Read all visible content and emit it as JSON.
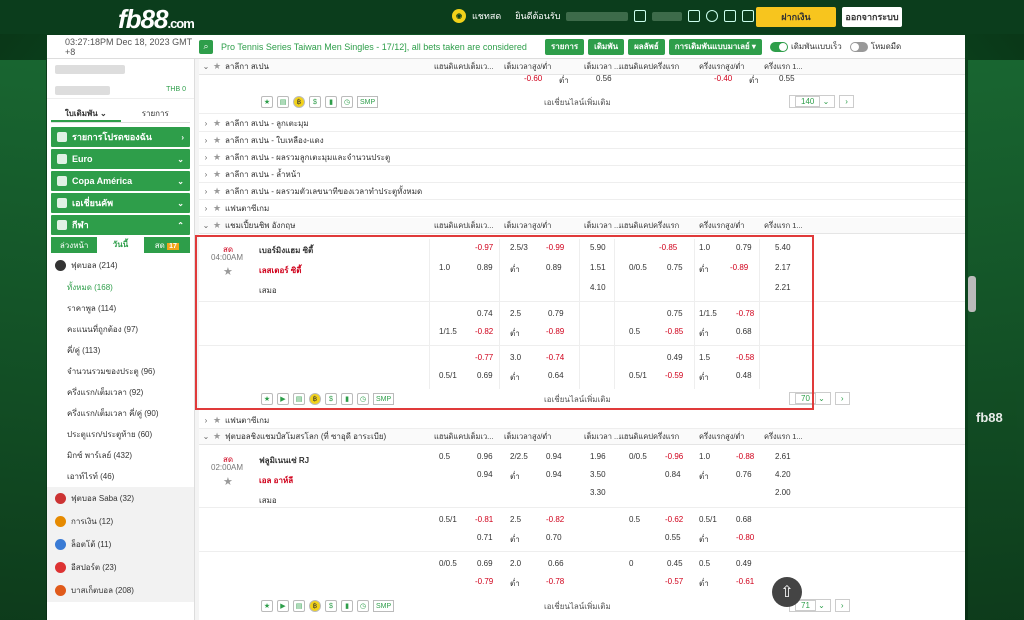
{
  "brand": {
    "logo": "fb88",
    "logo_suffix": ".com"
  },
  "header": {
    "chat_label": "แชทสด",
    "welcome": "ยินดีต้อนรับ",
    "deposit": "ฝากเงิน",
    "logout": "ออกจากระบบ"
  },
  "topbar": {
    "time": "03:27:18PM Dec 18, 2023 GMT +8",
    "ticker": "Pro Tennis Series Taiwan Men Singles - 17/12], all bets taken are considered",
    "btn1": "รายการ",
    "btn2": "เดิมพัน",
    "btn3": "ผลลัพธ์",
    "btn4": "การเดิมพันแบบมาเลย์",
    "toggle1": "เดิมพันแบบเร็ว",
    "toggle2": "โหมดมืด"
  },
  "sidebar": {
    "balance": "THB 0",
    "tab_bet": "ใบเดิมพัน",
    "tab_list": "รายการ",
    "acc1": "รายการโปรดของฉัน",
    "acc2": "Euro",
    "acc3": "Copa América",
    "acc4": "เอเชี่ยนคัพ",
    "acc5": "กีฬา",
    "sub_early": "ล่วงหน้า",
    "sub_today": "วันนี้",
    "sub_live": "สด",
    "live_count": "17",
    "football": "ฟุตบอล (214)",
    "items": [
      "ทั้งหมด (168)",
      "ราคาพูล (114)",
      "คะแนนที่ถูกต้อง (97)",
      "คี่/คู่ (113)",
      "จำนวนรวมของประตู (96)",
      "ครึ่งแรก/เต็มเวลา (92)",
      "ครึ่งแรก/เต็มเวลา คี่/คู่ (90)",
      "ประตูแรก/ประตูท้าย (60)",
      "มิกซ์ พาร์เลย์ (432)",
      "เอาท์ไรท์ (46)"
    ],
    "sports": [
      "ฟุตบอล Saba (32)",
      "การเงิน (12)",
      "ล็อตโต้ (11)",
      "อีสปอร์ต (23)",
      "บาสเก็ตบอล (208)"
    ]
  },
  "cols": {
    "c1": "แฮนดิแคปเต็มเว...",
    "c2": "เต็มเวลาสูง/ต่ำ",
    "c3": "เต็มเวลา ...",
    "c4": "แฮนดิแคปครึ่งแรก",
    "c5": "ครึ่งแรกสูง/ต่ำ",
    "c6": "ครึ่งแรก 1..."
  },
  "leagues": {
    "spain": "ลาลีกา สเปน",
    "l1": "ลาลีกา สเปน - ลูกเตะมุม",
    "l2": "ลาลีกา สเปน - ใบเหลือง-แดง",
    "l3": "ลาลีกา สเปน - ผลรวมลูกเตะมุมและจำนวนประตู",
    "l4": "ลาลีกา สเปน - ล้ำหน้า",
    "l5": "ลาลีกา สเปน - ผลรวมตัวเลขนาทีของเวลาทำประตูทั้งหมด",
    "fan": "แฟนตาซีเกม",
    "epl": "แชมเปี้ยนชิพ อังกฤษ",
    "fan2": "แฟนตาซีเกม",
    "cwc": "ฟุตบอลชิงแชมป์สโมสรโลก (ที่ ซาอุดี อาระเบีย)"
  },
  "top": {
    "v1": "-0.60",
    "v2": "ต่ำ",
    "v3": "0.56",
    "v4": "-0.40",
    "v5": "ต่ำ",
    "v6": "0.55",
    "more": "เอเชี่ยนไลน์เพิ่มเติม",
    "count": "140"
  },
  "m1": {
    "status": "สด",
    "time": "04:00AM",
    "home": "เบอร์มิงแฮม ซิตี้",
    "away": "เลสเตอร์ ซิตี้",
    "draw": "เสมอ",
    "count": "70",
    "more": "เอเชี่ยนไลน์เพิ่มเติม",
    "r1": [
      "-0.97",
      "2.5/3",
      "-0.99",
      "5.90",
      "-0.85",
      "1.0",
      "0.79",
      "5.40"
    ],
    "r2": [
      "1.0",
      "0.89",
      "ต่ำ",
      "0.89",
      "1.51",
      "0/0.5",
      "0.75",
      "ต่ำ",
      "-0.89",
      "2.17"
    ],
    "r3": [
      "4.10",
      "2.21"
    ],
    "r4": [
      "0.74",
      "2.5",
      "0.79",
      "0.75",
      "1/1.5",
      "-0.78"
    ],
    "r5": [
      "1/1.5",
      "-0.82",
      "ต่ำ",
      "-0.89",
      "0.5",
      "-0.85",
      "ต่ำ",
      "0.68"
    ],
    "r6": [
      "-0.77",
      "3.0",
      "-0.74",
      "0.49",
      "1.5",
      "-0.58"
    ],
    "r7": [
      "0.5/1",
      "0.69",
      "ต่ำ",
      "0.64",
      "0.5/1",
      "-0.59",
      "ต่ำ",
      "0.48"
    ]
  },
  "m2": {
    "status": "สด",
    "time": "02:00AM",
    "home": "ฟลูมิเนนเซ่ RJ",
    "away": "เอล อาห์ลี",
    "draw": "เสมอ",
    "count": "71",
    "more": "เอเชี่ยนไลน์เพิ่มเติม",
    "r1": [
      "0.5",
      "0.96",
      "2/2.5",
      "0.94",
      "1.96",
      "0/0.5",
      "-0.96",
      "1.0",
      "-0.88",
      "2.61"
    ],
    "r2": [
      "0.94",
      "ต่ำ",
      "0.94",
      "3.50",
      "0.84",
      "ต่ำ",
      "0.76",
      "4.20"
    ],
    "r3": [
      "3.30",
      "2.00"
    ],
    "r4": [
      "0.5/1",
      "-0.81",
      "2.5",
      "-0.82",
      "0.5",
      "-0.62",
      "0.5/1",
      "0.68"
    ],
    "r5": [
      "0.71",
      "ต่ำ",
      "0.70",
      "0.55",
      "ต่ำ",
      "-0.80"
    ],
    "r6": [
      "0/0.5",
      "0.69",
      "2.0",
      "0.66",
      "0",
      "0.45",
      "0.5",
      "0.49"
    ],
    "r7": [
      "-0.79",
      "ต่ำ",
      "-0.78",
      "-0.57",
      "ต่ำ",
      "-0.61"
    ]
  }
}
